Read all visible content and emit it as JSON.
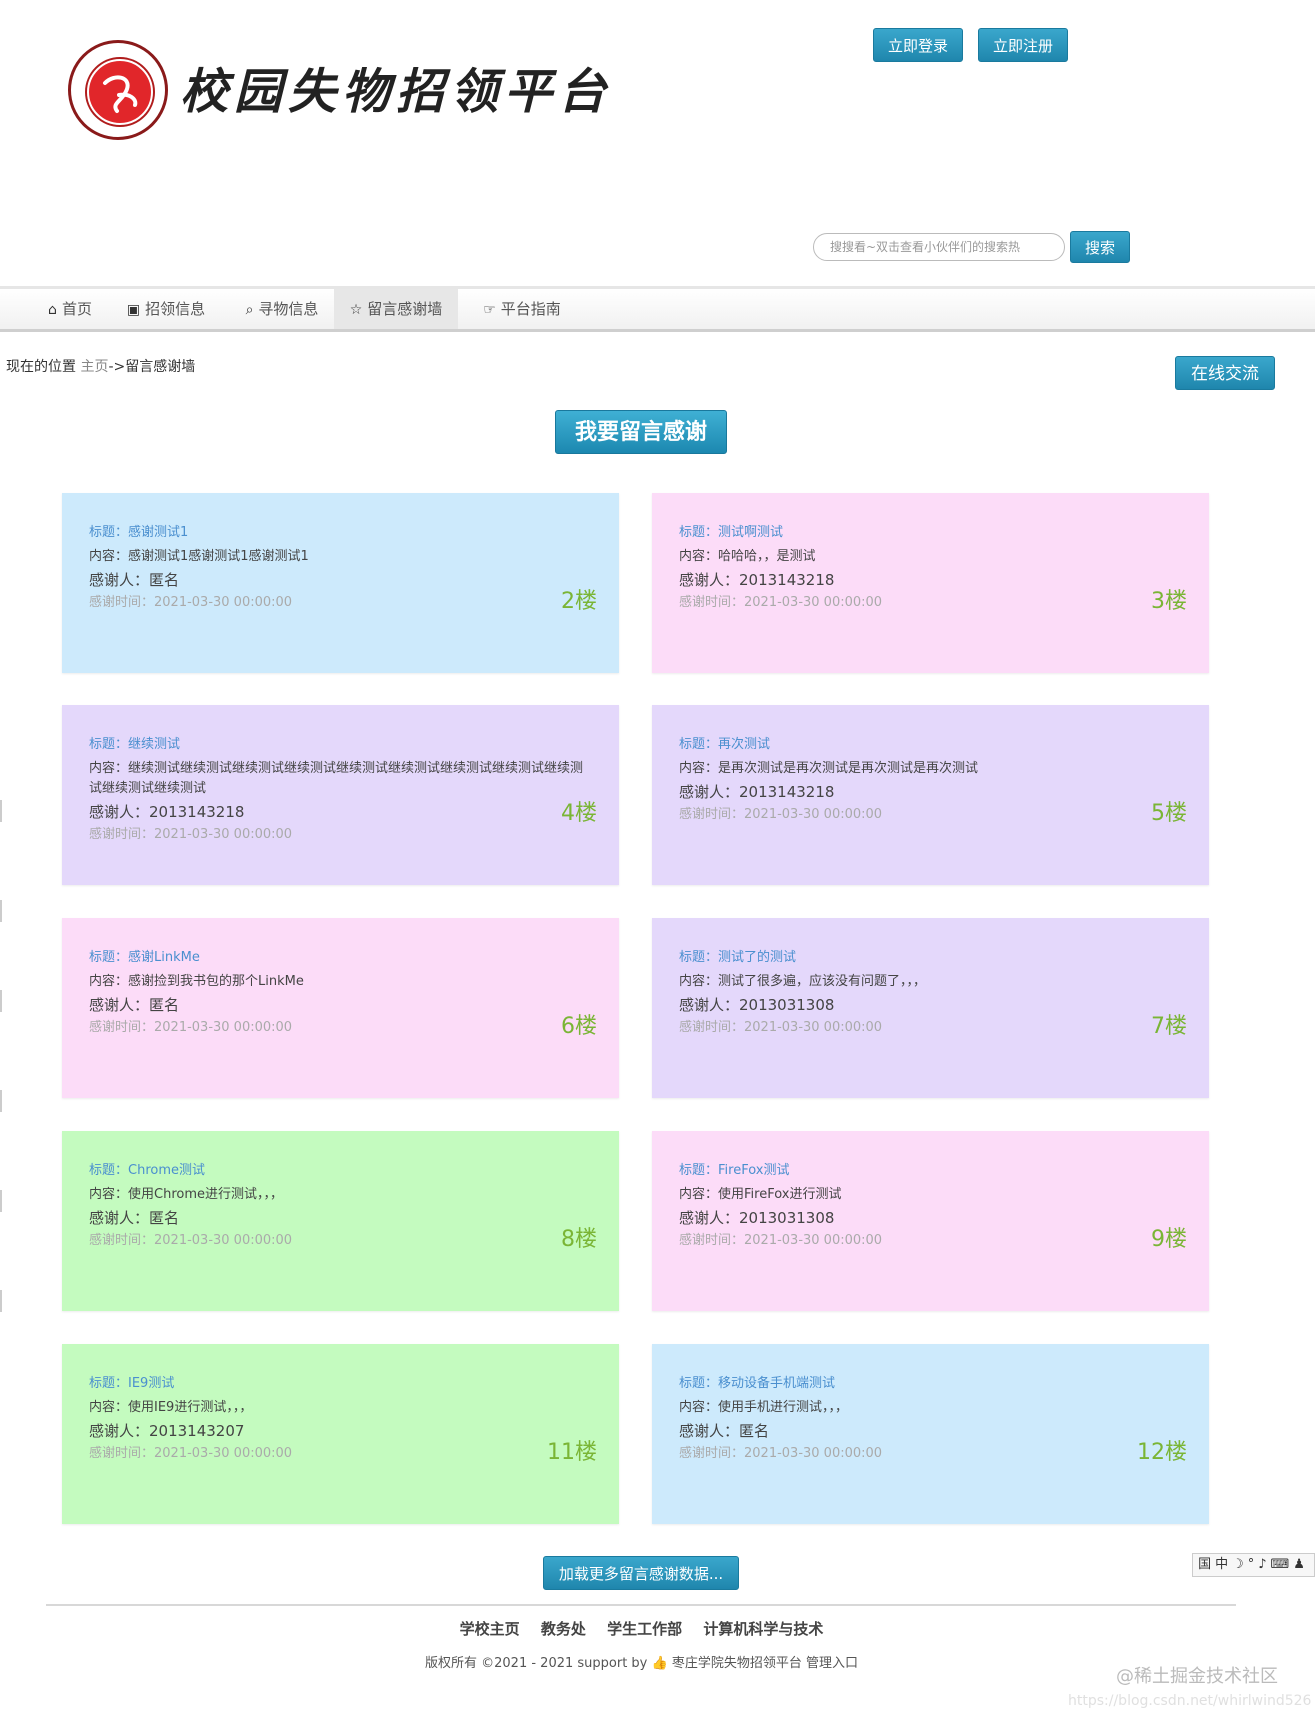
{
  "header": {
    "site_title": "校园失物招领平台",
    "login_label": "立即登录",
    "register_label": "立即注册",
    "search_placeholder": "搜搜看~双击查看小伙伴们的搜索热",
    "search_label": "搜索"
  },
  "nav": {
    "items": [
      {
        "label": "首页",
        "icon": "home-icon"
      },
      {
        "label": "招领信息",
        "icon": "picture-icon"
      },
      {
        "label": "寻物信息",
        "icon": "search-icon"
      },
      {
        "label": "留言感谢墙",
        "icon": "star-icon",
        "active": true
      },
      {
        "label": "平台指南",
        "icon": "hand-point-icon"
      }
    ]
  },
  "breadcrumb": {
    "prefix": "现在的位置",
    "home": "主页",
    "sep": "->",
    "current": "留言感谢墙"
  },
  "chat_label": "在线交流",
  "cta_label": "我要留言感谢",
  "cards": [
    {
      "title": "标题：感谢测试1",
      "content": "内容：感谢测试1感谢测试1感谢测试1",
      "person": "感谢人：匿名",
      "time": "感谢时间：2021-03-30 00:00:00",
      "floor": "2楼",
      "color": "#cdeafc"
    },
    {
      "title": "标题：测试啊测试",
      "content": "内容：哈哈哈，，是测试",
      "person": "感谢人：2013143218",
      "time": "感谢时间：2021-03-30 00:00:00",
      "floor": "3楼",
      "color": "#fcdcf8"
    },
    {
      "title": "标题：继续测试",
      "content": "内容：继续测试继续测试继续测试继续测试继续测试继续测试继续测试继续测试继续测试继续测试继续测试",
      "person": "感谢人：2013143218",
      "time": "感谢时间：2021-03-30 00:00:00",
      "floor": "4楼",
      "color": "#e4d8fb"
    },
    {
      "title": "标题：再次测试",
      "content": "内容：是再次测试是再次测试是再次测试是再次测试",
      "person": "感谢人：2013143218",
      "time": "感谢时间：2021-03-30 00:00:00",
      "floor": "5楼",
      "color": "#e4d8fb"
    },
    {
      "title": "标题：感谢LinkMe",
      "content": "内容：感谢捡到我书包的那个LinkMe",
      "person": "感谢人：匿名",
      "time": "感谢时间：2021-03-30 00:00:00",
      "floor": "6楼",
      "color": "#fcdcf8"
    },
    {
      "title": "标题：测试了的测试",
      "content": "内容：测试了很多遍，应该没有问题了，，，",
      "person": "感谢人：2013031308",
      "time": "感谢时间：2021-03-30 00:00:00",
      "floor": "7楼",
      "color": "#e4d8fb"
    },
    {
      "title": "标题：Chrome测试",
      "content": "内容：使用Chrome进行测试，，，",
      "person": "感谢人：匿名",
      "time": "感谢时间：2021-03-30 00:00:00",
      "floor": "8楼",
      "color": "#c4fbbf"
    },
    {
      "title": "标题：FireFox测试",
      "content": "内容：使用FireFox进行测试",
      "person": "感谢人：2013031308",
      "time": "感谢时间：2021-03-30 00:00:00",
      "floor": "9楼",
      "color": "#fcdcf8"
    },
    {
      "title": "标题：IE9测试",
      "content": "内容：使用IE9进行测试，，，",
      "person": "感谢人：2013143207",
      "time": "感谢时间：2021-03-30 00:00:00",
      "floor": "11楼",
      "color": "#c4fbbf"
    },
    {
      "title": "标题：移动设备手机端测试",
      "content": "内容：使用手机进行测试，，，",
      "person": "感谢人：匿名",
      "time": "感谢时间：2021-03-30 00:00:00",
      "floor": "12楼",
      "color": "#cdeafc"
    }
  ],
  "load_more_label": "加载更多留言感谢数据...",
  "ime_bar": "国中☽°♪⌨♟",
  "footer": {
    "links": [
      "学校主页",
      "教务处",
      "学生工作部",
      "计算机科学与技术"
    ],
    "copyright_prefix": "版权所有 ©2021 - 2021 support by",
    "copyright_suffix": "枣庄学院失物招领平台 管理入口"
  },
  "watermark": {
    "primary": "@稀土掘金技术社区",
    "secondary": "https://blog.csdn.net/whirlwind526"
  }
}
